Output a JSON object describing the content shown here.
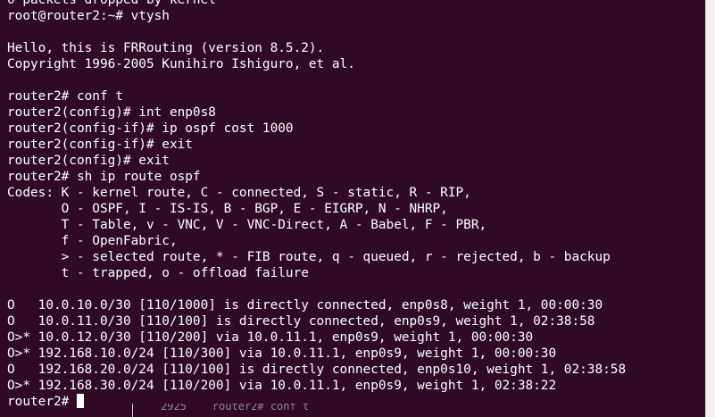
{
  "terminal": {
    "lines": [
      "0 packets dropped by kernel",
      "root@router2:~# vtysh",
      "",
      "Hello, this is FRRouting (version 8.5.2).",
      "Copyright 1996-2005 Kunihiro Ishiguro, et al.",
      "",
      "router2# conf t",
      "router2(config)# int enp0s8",
      "router2(config-if)# ip ospf cost 1000",
      "router2(config-if)# exit",
      "router2(config)# exit",
      "router2# sh ip route ospf",
      "Codes: K - kernel route, C - connected, S - static, R - RIP,",
      "       O - OSPF, I - IS-IS, B - BGP, E - EIGRP, N - NHRP,",
      "       T - Table, v - VNC, V - VNC-Direct, A - Babel, F - PBR,",
      "       f - OpenFabric,",
      "       > - selected route, * - FIB route, q - queued, r - rejected, b - backup",
      "       t - trapped, o - offload failure",
      "",
      "O   10.0.10.0/30 [110/1000] is directly connected, enp0s8, weight 1, 00:00:30",
      "O   10.0.11.0/30 [110/100] is directly connected, enp0s9, weight 1, 02:38:58",
      "O>* 10.0.12.0/30 [110/200] via 10.0.11.1, enp0s9, weight 1, 00:00:30",
      "O>* 192.168.10.0/24 [110/300] via 10.0.11.1, enp0s9, weight 1, 00:00:30",
      "O   192.168.20.0/24 [110/100] is directly connected, enp0s10, weight 1, 02:38:58",
      "O>* 192.168.30.0/24 [110/200] via 10.0.11.1, enp0s9, weight 1, 02:38:22"
    ],
    "prompt": "router2# "
  },
  "background_window": {
    "text": "2925    router2# conf t"
  },
  "colors": {
    "terminal_bg": "#300a24",
    "terminal_fg": "#ffffff",
    "side_panel": "#f2f1f0"
  }
}
